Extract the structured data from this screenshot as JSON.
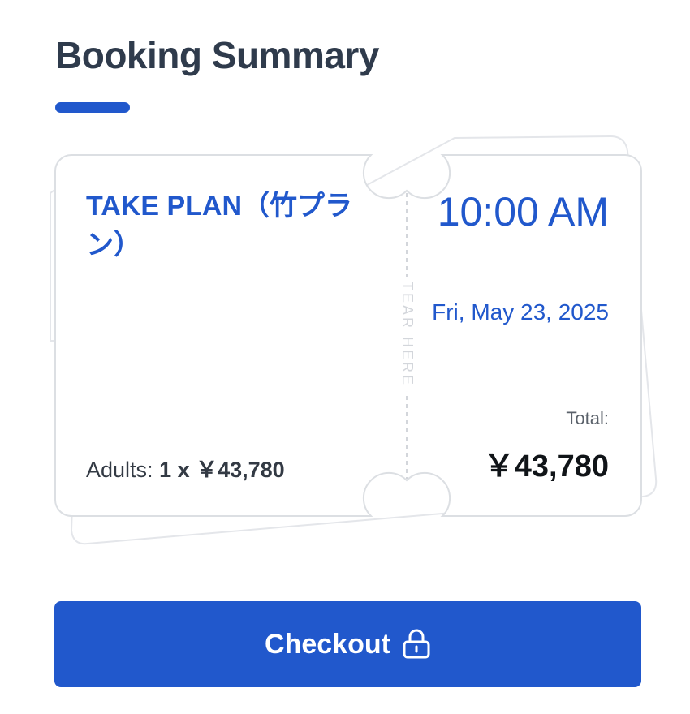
{
  "header": {
    "title": "Booking Summary"
  },
  "ticket": {
    "plan_name": "TAKE PLAN（竹プラン）",
    "adults_label": "Adults:",
    "adults_quantity": "1 x ￥43,780",
    "tear_label": "TEAR HERE",
    "time": "10:00 AM",
    "date": "Fri, May 23, 2025",
    "total_label": "Total:",
    "total_value": "￥43,780"
  },
  "checkout": {
    "label": "Checkout",
    "icon": "lock-icon"
  },
  "colors": {
    "accent": "#2158cc",
    "title": "#2f3b4c",
    "ticket_border": "#dcdfe3"
  }
}
